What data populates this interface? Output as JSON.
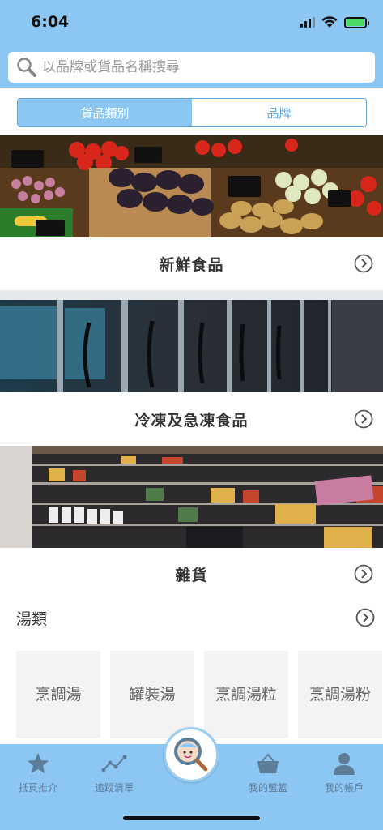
{
  "status": {
    "time": "6:04"
  },
  "search": {
    "placeholder": "以品牌或貨品名稱搜尋"
  },
  "segments": {
    "category": "貨品類別",
    "brand": "品牌",
    "selected": "category"
  },
  "categories": [
    {
      "label": "新鮮食品"
    },
    {
      "label": "冷凍及急凍食品"
    },
    {
      "label": "雜貨"
    }
  ],
  "soup": {
    "title": "湯類",
    "items": [
      "烹調湯",
      "罐裝湯",
      "烹調湯粒",
      "烹調湯粉"
    ]
  },
  "tabs": [
    {
      "label": "抵買推介",
      "icon": "star-icon"
    },
    {
      "label": "追蹤清單",
      "icon": "trend-icon"
    },
    {
      "label": "我的籃籃",
      "icon": "basket-icon"
    },
    {
      "label": "我的帳戶",
      "icon": "user-icon"
    }
  ],
  "colors": {
    "accent": "#8cc6f3",
    "accent_dark": "#5fa7e0",
    "tab_label": "#5c7c98"
  }
}
